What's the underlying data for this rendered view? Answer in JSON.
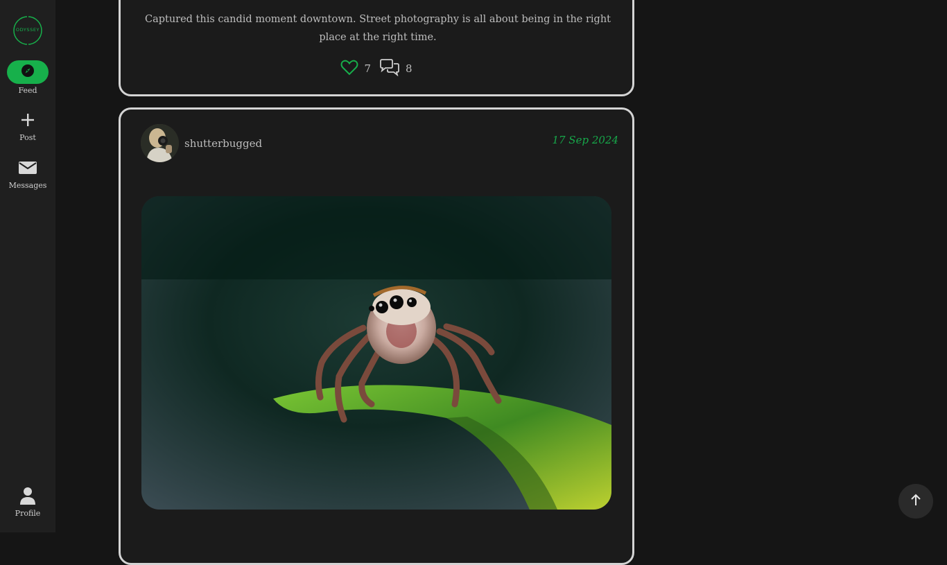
{
  "brand": {
    "logo_text": "ODYSSEY",
    "accent_color": "#17b04b"
  },
  "sidebar": {
    "items": [
      {
        "label": "Feed",
        "icon": "compass-icon",
        "active": true
      },
      {
        "label": "Post",
        "icon": "plus-icon",
        "active": false
      },
      {
        "label": "Messages",
        "icon": "envelope-icon",
        "active": false
      },
      {
        "label": "Profile",
        "icon": "user-icon",
        "active": false
      }
    ]
  },
  "feed": {
    "posts": [
      {
        "caption": "Captured this candid moment downtown. Street photography is all about being in the right place at the right time.",
        "likes": "7",
        "comments": "8"
      },
      {
        "username": "shutterbugged",
        "date": "17 Sep 2024",
        "image": "jumping-spider-on-leaf"
      }
    ]
  },
  "scroll_top": {
    "icon": "arrow-up-icon"
  }
}
